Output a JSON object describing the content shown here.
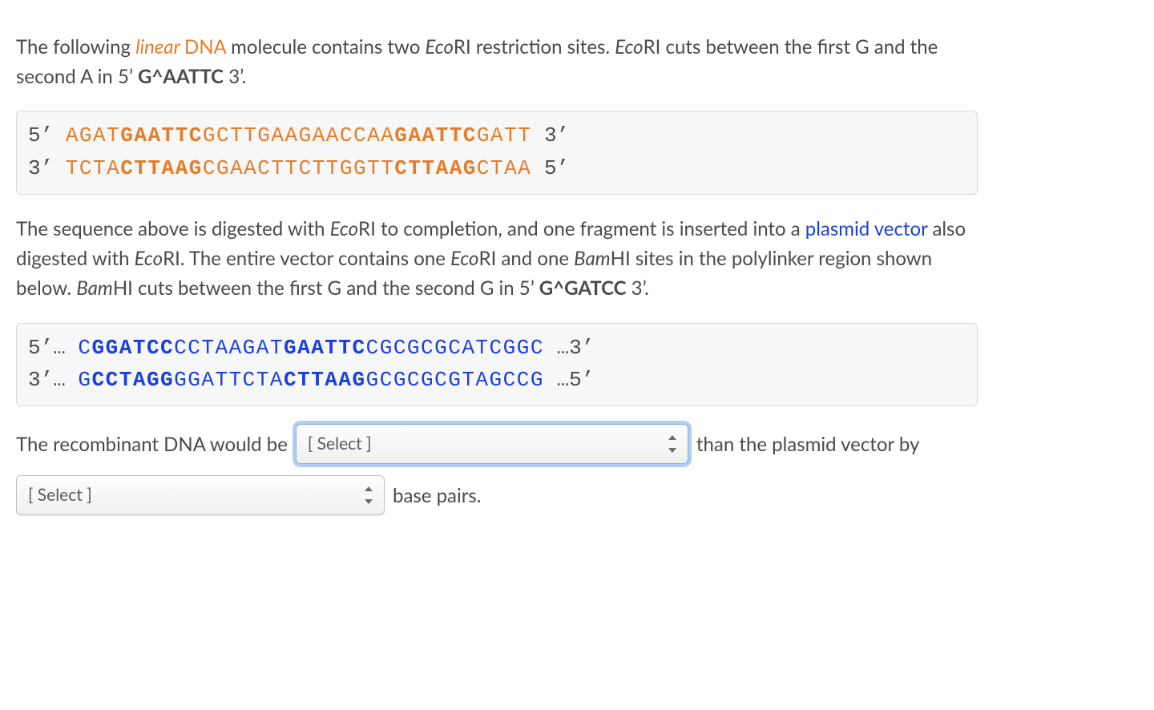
{
  "paragraph1": {
    "pre": "The following ",
    "linear": "linear",
    "dna": "DNA",
    "mid1": " molecule contains two ",
    "eco_prefix": "Eco",
    "eco_suffix": "RI",
    "mid2": " restriction sites. ",
    "mid3": " cuts between the first G and the second A in 5’ ",
    "site": "G^AATTC",
    "mid4": " 3’."
  },
  "seq1": {
    "line1": {
      "lead": "5’ ",
      "p0": "AGAT",
      "p1": "GAATTC",
      "p2": "GCTTGAAGAACCAA",
      "p3": "GAATTC",
      "p4": "GATT",
      "tail": " 3’"
    },
    "line2": {
      "lead": "3’ ",
      "p0": "TCTA",
      "p1": "CTTAAG",
      "p2": "CGAACTTCTTGGTT",
      "p3": "CTTAAG",
      "p4": "CTAA",
      "tail": " 5’"
    }
  },
  "paragraph2": {
    "t0": "The sequence above is digested with ",
    "t1": " to completion, and one fragment is inserted into a ",
    "plasmid": "plasmid vector",
    "t2": " also digested with ",
    "t3": ". The entire vector contains one ",
    "t4": " and one ",
    "bam_prefix": "Bam",
    "bam_suffix": "HI",
    "t5": " sites in the polylinker region shown below. ",
    "t6": " cuts between the first G and the second G in 5’ ",
    "site": "G^GATCC",
    "t7": " 3’."
  },
  "seq2": {
    "line1": {
      "lead": "5’… ",
      "p0": "C",
      "p1": "GGATCC",
      "p2": "CCTAAGAT",
      "p3": "GAATTC",
      "p4": "CGCGCGCATCGGC",
      "tail": " …3’"
    },
    "line2": {
      "lead": "3’… ",
      "p0": "G",
      "p1": "CCTAGG",
      "p2": "GGATTCTA",
      "p3": "CTTAAG",
      "p4": "GCGCGCGTAGCCG",
      "tail": " …5’"
    }
  },
  "answer": {
    "lead": "The recombinant DNA would be",
    "select1_placeholder": "[ Select ]",
    "mid": " than the plasmid vector by",
    "select2_placeholder": "[ Select ]",
    "tail": " base pairs."
  }
}
